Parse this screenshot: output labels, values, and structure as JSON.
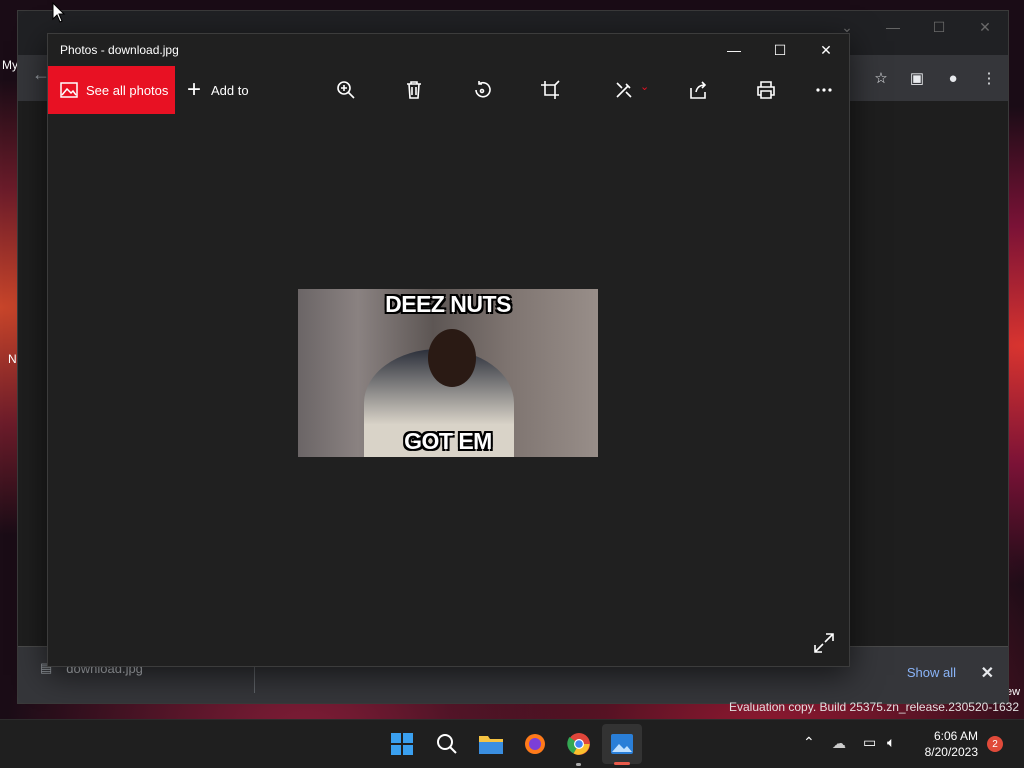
{
  "desktop": {
    "labels": [
      "My",
      "N",
      "ew"
    ]
  },
  "chrome": {
    "download_bar": {
      "file_name": "download.jpg",
      "show_all": "Show all"
    }
  },
  "photos": {
    "title": "Photos - download.jpg",
    "toolbar": {
      "see_all_photos": "See all photos",
      "add_to": "Add to",
      "tools": [
        "zoom-in-icon",
        "delete-icon",
        "rotate-icon",
        "crop-icon",
        "edit-icon",
        "share-icon",
        "print-icon",
        "more-icon"
      ]
    },
    "image": {
      "top_caption": "DEEZ NUTS",
      "bottom_caption": "GOT EM"
    }
  },
  "system": {
    "watermark": "Evaluation copy. Build 25375.zn_release.230520-1632",
    "time": "6:06 AM",
    "date": "8/20/2023",
    "notifications": "2"
  },
  "colors": {
    "accent_red": "#e81123",
    "link_blue": "#8ab4f8",
    "window_bg": "#202020"
  }
}
